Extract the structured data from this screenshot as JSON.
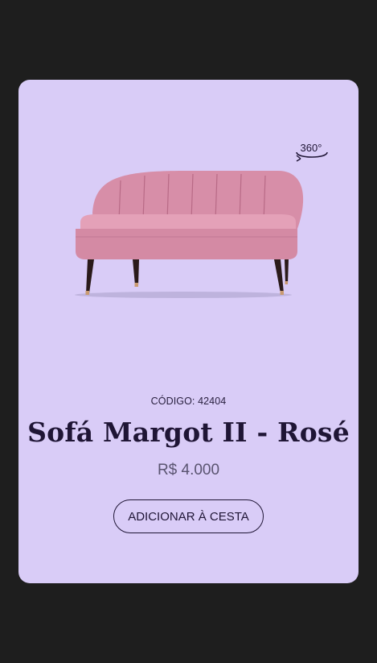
{
  "product": {
    "code_label": "CÓDIGO: 42404",
    "title": "Sofá Margot II - Rosé",
    "price": "R$ 4.000",
    "add_to_cart_label": "ADICIONAR À CESTA",
    "view_360_label": "360°",
    "image_alt": "pink-velvet-sofa"
  },
  "colors": {
    "page_background": "#1e1e1e",
    "card_background": "#d9ccf7",
    "title_text": "#1f1535",
    "price_text": "#5a5470",
    "sofa_fabric": "#d78ea8",
    "sofa_legs": "#2a1a1a"
  }
}
